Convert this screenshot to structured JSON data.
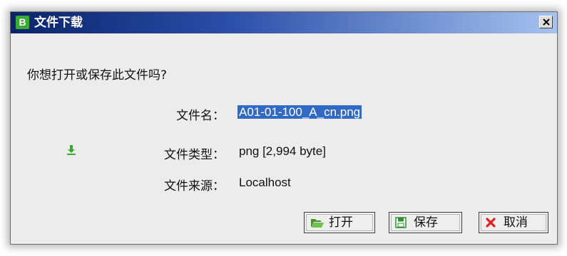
{
  "dialog": {
    "title": "文件下载",
    "logo_letter": "B",
    "question": "你想打开或保存此文件吗?",
    "fields": [
      {
        "label": "文件名：",
        "value": "A01-01-100_A_cn.png"
      },
      {
        "label": "文件类型：",
        "value": "png [2,994 byte]"
      },
      {
        "label": "文件来源：",
        "value": "Localhost"
      }
    ],
    "buttons": {
      "open": "打开",
      "save": "保存",
      "cancel": "取消"
    }
  },
  "icons": {
    "title_logo": "app-logo",
    "close": "close-icon",
    "file_type": "download-icon",
    "open": "folder-open-icon",
    "save": "floppy-disk-icon",
    "cancel": "red-x-icon"
  },
  "colors": {
    "title_gradient_start": "#0a246a",
    "title_gradient_end": "#a6c2ee",
    "selection": "#316ac5",
    "logo_green": "#3aa935"
  }
}
